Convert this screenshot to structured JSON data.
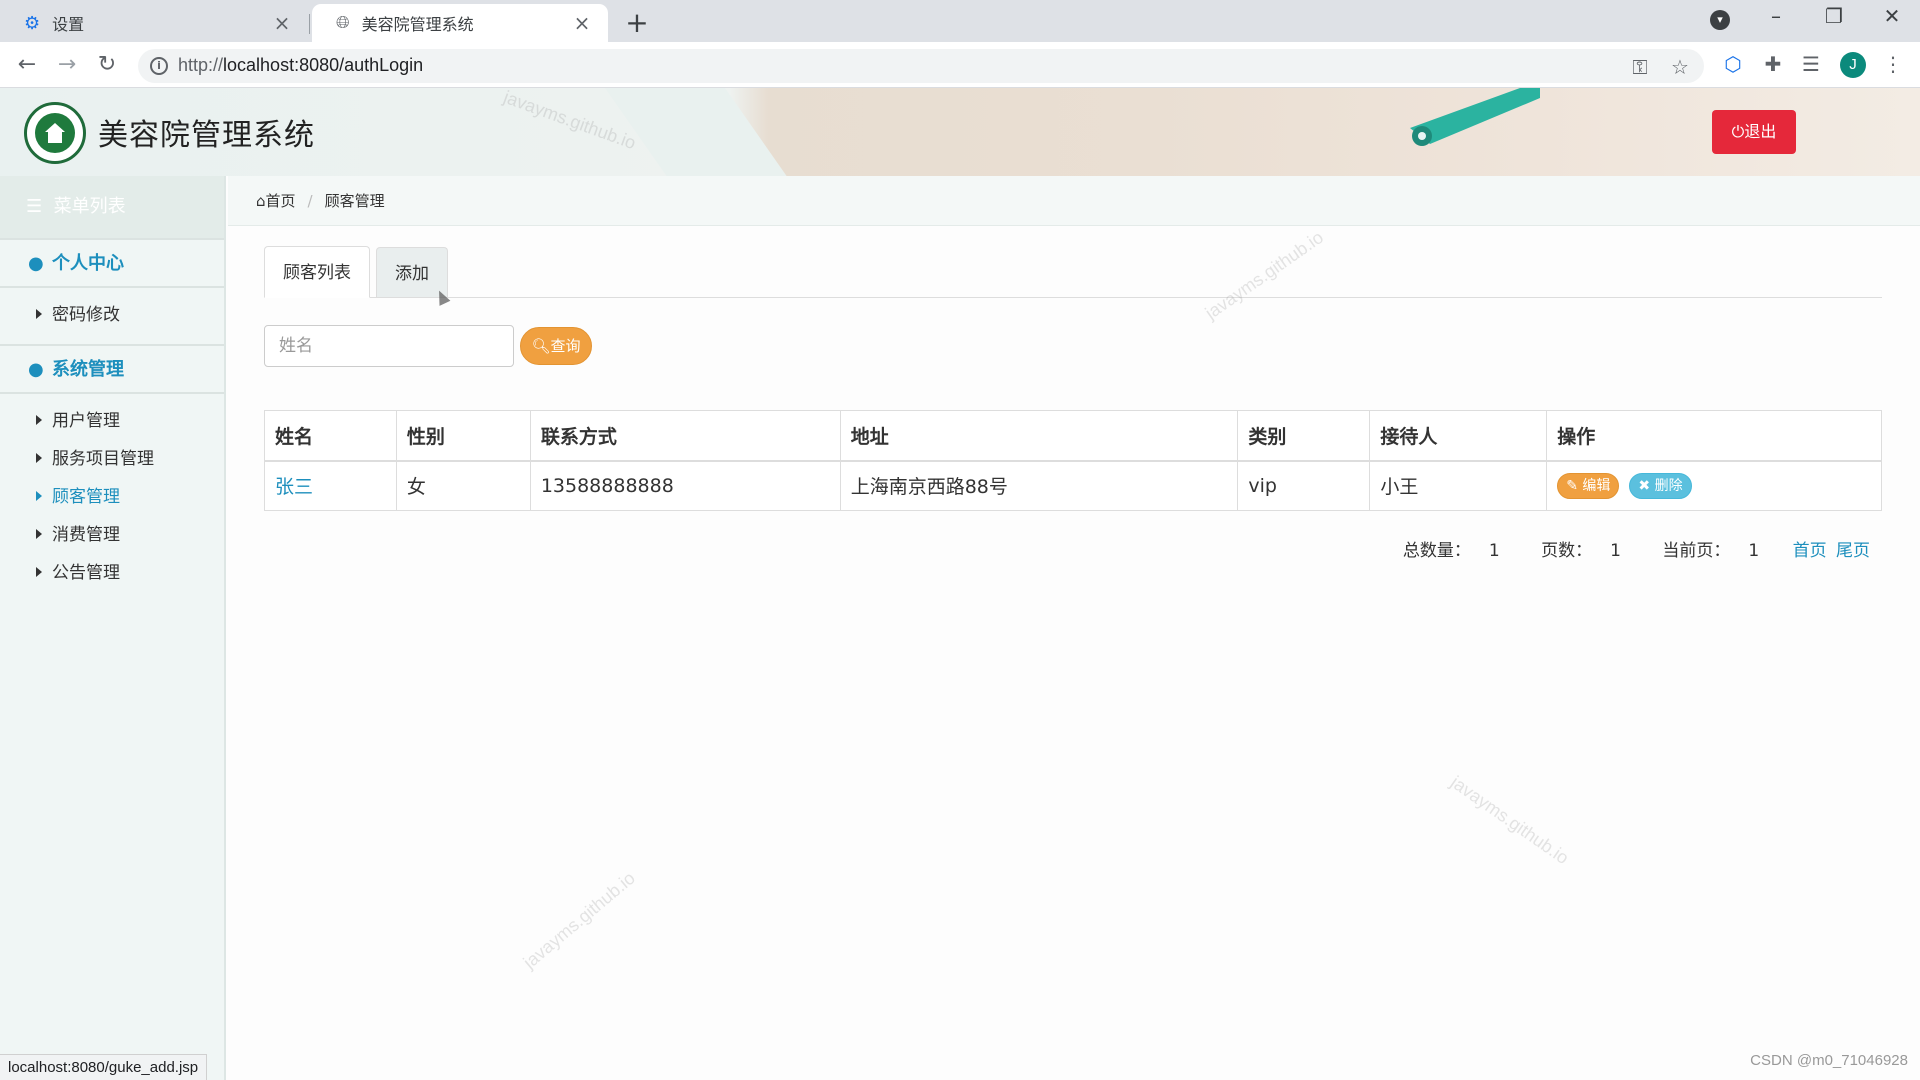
{
  "browser": {
    "tabs": [
      {
        "title": "设置",
        "icon": "gear-icon",
        "active": false
      },
      {
        "title": "美容院管理系统",
        "icon": "globe-icon",
        "active": true
      }
    ],
    "url_proto": "http://",
    "url_rest": "localhost:8080/authLogin",
    "status_url": "localhost:8080/guke_add.jsp",
    "profile_initial": "J"
  },
  "header": {
    "title": "美容院管理系统",
    "logout_label": "⏻退出",
    "logout_color": "#e5283a"
  },
  "sidebar": {
    "menu_title": "菜单列表",
    "groups": [
      {
        "label": "个人中心",
        "items": [
          "密码修改"
        ]
      },
      {
        "label": "系统管理",
        "items": [
          "用户管理",
          "服务项目管理",
          "顾客管理",
          "消费管理",
          "公告管理"
        ]
      }
    ],
    "active_item": "顾客管理",
    "accent_color": "#1d8fbd"
  },
  "breadcrumb": {
    "home": "首页",
    "current": "顾客管理"
  },
  "page_tabs": [
    "顾客列表",
    "添加"
  ],
  "search": {
    "placeholder": "姓名",
    "value": "",
    "button_label": "查询"
  },
  "table": {
    "headers": [
      "姓名",
      "性别",
      "联系方式",
      "地址",
      "类别",
      "接待人",
      "操作"
    ],
    "rows": [
      {
        "name": "张三",
        "gender": "女",
        "phone": "13588888888",
        "address": "上海南京西路88号",
        "category": "vip",
        "receptionist": "小王",
        "edit_label": "编辑",
        "delete_label": "删除"
      }
    ]
  },
  "pager": {
    "total_label": "总数量：",
    "total": "1",
    "pages_label": "页数：",
    "pages": "1",
    "current_label": "当前页：",
    "current": "1",
    "first": "首页",
    "last": "尾页"
  },
  "watermark_text": "javayms.github.io",
  "credit": "CSDN @m0_71046928"
}
